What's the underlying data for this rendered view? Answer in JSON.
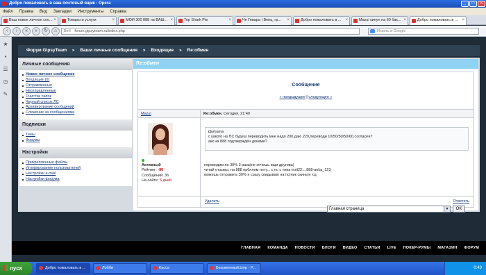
{
  "window": {
    "title": "Добро пожаловать в ваш почтовый ящик - Opera",
    "min": "_",
    "max": "□",
    "close": "×"
  },
  "menubar": [
    "Файл",
    "Правка",
    "Вид",
    "Закладки",
    "Инструменты",
    "Справка"
  ],
  "tabs": [
    {
      "label": "Ваш новое личное соо...",
      "active": false
    },
    {
      "label": "Товары и услуги",
      "active": false
    },
    {
      "label": "МОИ 300 888 на ВАШ...",
      "active": false
    },
    {
      "label": "Top Shark Pto",
      "active": false
    },
    {
      "label": "Че Гевара | Венц, гр...",
      "active": false
    },
    {
      "label": "Добро пожаловать в ...",
      "active": false
    },
    {
      "label": "Mazui кинул на 60 бак...",
      "active": false
    },
    {
      "label": "Добро пожаловать в ...",
      "active": true
    }
  ],
  "address": {
    "web_label": "Веб",
    "url": "forum.gipsyteam.ru/index.php",
    "search_placeholder": "Искать в Google"
  },
  "breadcrumb": {
    "root": "Форум GipsyTeam",
    "sep": "»",
    "level1": "Ваши личные сообщения",
    "level2": "Входящие",
    "level3": "Re:обмен"
  },
  "sidebar": {
    "sections": [
      {
        "title": "Личные сообщения",
        "items": [
          {
            "label": "Новое личное сообщение",
            "bold": true
          },
          {
            "label": "Входящие (0)",
            "bold": false
          },
          {
            "label": "Отправленные",
            "bold": false
          },
          {
            "label": "Неотправленные",
            "bold": false
          },
          {
            "label": "Очистка папок",
            "bold": false
          },
          {
            "label": "Черный список ЛС",
            "bold": false
          },
          {
            "label": "Архивирование сообщений",
            "bold": false
          },
          {
            "label": "Слежение за сообщениями",
            "bold": false
          }
        ]
      },
      {
        "title": "Подписки",
        "items": [
          {
            "label": "Темы",
            "bold": false
          },
          {
            "label": "Форумы",
            "bold": false
          }
        ]
      },
      {
        "title": "Настройки",
        "items": [
          {
            "label": "Прикрепленные файлы",
            "bold": false
          },
          {
            "label": "Игнорирование пользователей",
            "bold": false
          },
          {
            "label": "Настройки e-mail",
            "bold": false
          },
          {
            "label": "Настройки форума",
            "bold": false
          }
        ]
      }
    ]
  },
  "main": {
    "header": "Re:обмен",
    "title": "Сообщение",
    "pager_prev": "« предыдущее",
    "pager_sep": "|",
    "pager_next": "следующее »",
    "author": "Mazui",
    "subject_bold": "Re:обмен",
    "subject_rest": ", Сегодня, 21:49",
    "user": {
      "status": "Активный",
      "rating_label": "Рейтинг:",
      "rating_value": "-90",
      "posts_label": "Сообщений:",
      "posts_value": "36",
      "online_label": "На сайте:",
      "online_value": "6 дней"
    },
    "quote": {
      "label": "Цитата",
      "line1": "с какого на ПС будеш переводить мне надо 200,даю 220,переводи 10/50/50/50/60.согласен?",
      "line2": "акк на 888 подтверждён доками?"
    },
    "body": [
      "переводим по 30% 3 раза(не хочешь ищи другова)",
      "читай отзывы. на 888 прбллем нету... с пс с ника troit22....888-anka_123",
      "можешь отправить 30% я сразу скидываю на пс(ник скинь)н т.д"
    ],
    "delete": "Удалить",
    "reply": "Ответить",
    "jump_select": "Главная страница",
    "ok": "OK"
  },
  "bottom_nav": [
    "ГЛАВНАЯ",
    "КОМАНДА",
    "НОВОСТИ",
    "БЛОГИ",
    "ВИДЕО",
    "СТАТЬИ",
    "LIVE",
    "ПОКЕР-РУМЫ",
    "МАГАЗИН",
    "ФОРУМ"
  ],
  "taskbar": {
    "start": "пуск",
    "items": [
      {
        "label": "Добро пожаловать в ...",
        "active": true
      },
      {
        "label": "Лобби",
        "active": false
      },
      {
        "label": "Касса",
        "active": false
      },
      {
        "label": "Безымянный.bmp - Р...",
        "active": false
      }
    ],
    "lang": "EN",
    "clock": "0:49"
  }
}
